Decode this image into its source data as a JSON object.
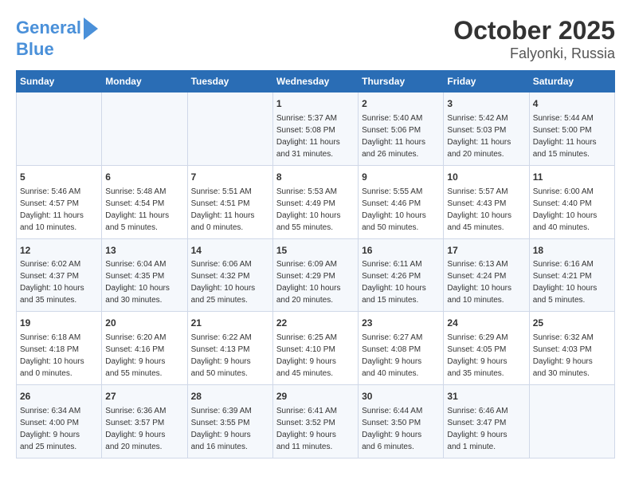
{
  "logo": {
    "line1": "General",
    "line2": "Blue"
  },
  "title": "October 2025",
  "subtitle": "Falyonki, Russia",
  "weekdays": [
    "Sunday",
    "Monday",
    "Tuesday",
    "Wednesday",
    "Thursday",
    "Friday",
    "Saturday"
  ],
  "weeks": [
    [
      {
        "day": "",
        "info": ""
      },
      {
        "day": "",
        "info": ""
      },
      {
        "day": "",
        "info": ""
      },
      {
        "day": "1",
        "info": "Sunrise: 5:37 AM\nSunset: 5:08 PM\nDaylight: 11 hours\nand 31 minutes."
      },
      {
        "day": "2",
        "info": "Sunrise: 5:40 AM\nSunset: 5:06 PM\nDaylight: 11 hours\nand 26 minutes."
      },
      {
        "day": "3",
        "info": "Sunrise: 5:42 AM\nSunset: 5:03 PM\nDaylight: 11 hours\nand 20 minutes."
      },
      {
        "day": "4",
        "info": "Sunrise: 5:44 AM\nSunset: 5:00 PM\nDaylight: 11 hours\nand 15 minutes."
      }
    ],
    [
      {
        "day": "5",
        "info": "Sunrise: 5:46 AM\nSunset: 4:57 PM\nDaylight: 11 hours\nand 10 minutes."
      },
      {
        "day": "6",
        "info": "Sunrise: 5:48 AM\nSunset: 4:54 PM\nDaylight: 11 hours\nand 5 minutes."
      },
      {
        "day": "7",
        "info": "Sunrise: 5:51 AM\nSunset: 4:51 PM\nDaylight: 11 hours\nand 0 minutes."
      },
      {
        "day": "8",
        "info": "Sunrise: 5:53 AM\nSunset: 4:49 PM\nDaylight: 10 hours\nand 55 minutes."
      },
      {
        "day": "9",
        "info": "Sunrise: 5:55 AM\nSunset: 4:46 PM\nDaylight: 10 hours\nand 50 minutes."
      },
      {
        "day": "10",
        "info": "Sunrise: 5:57 AM\nSunset: 4:43 PM\nDaylight: 10 hours\nand 45 minutes."
      },
      {
        "day": "11",
        "info": "Sunrise: 6:00 AM\nSunset: 4:40 PM\nDaylight: 10 hours\nand 40 minutes."
      }
    ],
    [
      {
        "day": "12",
        "info": "Sunrise: 6:02 AM\nSunset: 4:37 PM\nDaylight: 10 hours\nand 35 minutes."
      },
      {
        "day": "13",
        "info": "Sunrise: 6:04 AM\nSunset: 4:35 PM\nDaylight: 10 hours\nand 30 minutes."
      },
      {
        "day": "14",
        "info": "Sunrise: 6:06 AM\nSunset: 4:32 PM\nDaylight: 10 hours\nand 25 minutes."
      },
      {
        "day": "15",
        "info": "Sunrise: 6:09 AM\nSunset: 4:29 PM\nDaylight: 10 hours\nand 20 minutes."
      },
      {
        "day": "16",
        "info": "Sunrise: 6:11 AM\nSunset: 4:26 PM\nDaylight: 10 hours\nand 15 minutes."
      },
      {
        "day": "17",
        "info": "Sunrise: 6:13 AM\nSunset: 4:24 PM\nDaylight: 10 hours\nand 10 minutes."
      },
      {
        "day": "18",
        "info": "Sunrise: 6:16 AM\nSunset: 4:21 PM\nDaylight: 10 hours\nand 5 minutes."
      }
    ],
    [
      {
        "day": "19",
        "info": "Sunrise: 6:18 AM\nSunset: 4:18 PM\nDaylight: 10 hours\nand 0 minutes."
      },
      {
        "day": "20",
        "info": "Sunrise: 6:20 AM\nSunset: 4:16 PM\nDaylight: 9 hours\nand 55 minutes."
      },
      {
        "day": "21",
        "info": "Sunrise: 6:22 AM\nSunset: 4:13 PM\nDaylight: 9 hours\nand 50 minutes."
      },
      {
        "day": "22",
        "info": "Sunrise: 6:25 AM\nSunset: 4:10 PM\nDaylight: 9 hours\nand 45 minutes."
      },
      {
        "day": "23",
        "info": "Sunrise: 6:27 AM\nSunset: 4:08 PM\nDaylight: 9 hours\nand 40 minutes."
      },
      {
        "day": "24",
        "info": "Sunrise: 6:29 AM\nSunset: 4:05 PM\nDaylight: 9 hours\nand 35 minutes."
      },
      {
        "day": "25",
        "info": "Sunrise: 6:32 AM\nSunset: 4:03 PM\nDaylight: 9 hours\nand 30 minutes."
      }
    ],
    [
      {
        "day": "26",
        "info": "Sunrise: 6:34 AM\nSunset: 4:00 PM\nDaylight: 9 hours\nand 25 minutes."
      },
      {
        "day": "27",
        "info": "Sunrise: 6:36 AM\nSunset: 3:57 PM\nDaylight: 9 hours\nand 20 minutes."
      },
      {
        "day": "28",
        "info": "Sunrise: 6:39 AM\nSunset: 3:55 PM\nDaylight: 9 hours\nand 16 minutes."
      },
      {
        "day": "29",
        "info": "Sunrise: 6:41 AM\nSunset: 3:52 PM\nDaylight: 9 hours\nand 11 minutes."
      },
      {
        "day": "30",
        "info": "Sunrise: 6:44 AM\nSunset: 3:50 PM\nDaylight: 9 hours\nand 6 minutes."
      },
      {
        "day": "31",
        "info": "Sunrise: 6:46 AM\nSunset: 3:47 PM\nDaylight: 9 hours\nand 1 minute."
      },
      {
        "day": "",
        "info": ""
      }
    ]
  ]
}
